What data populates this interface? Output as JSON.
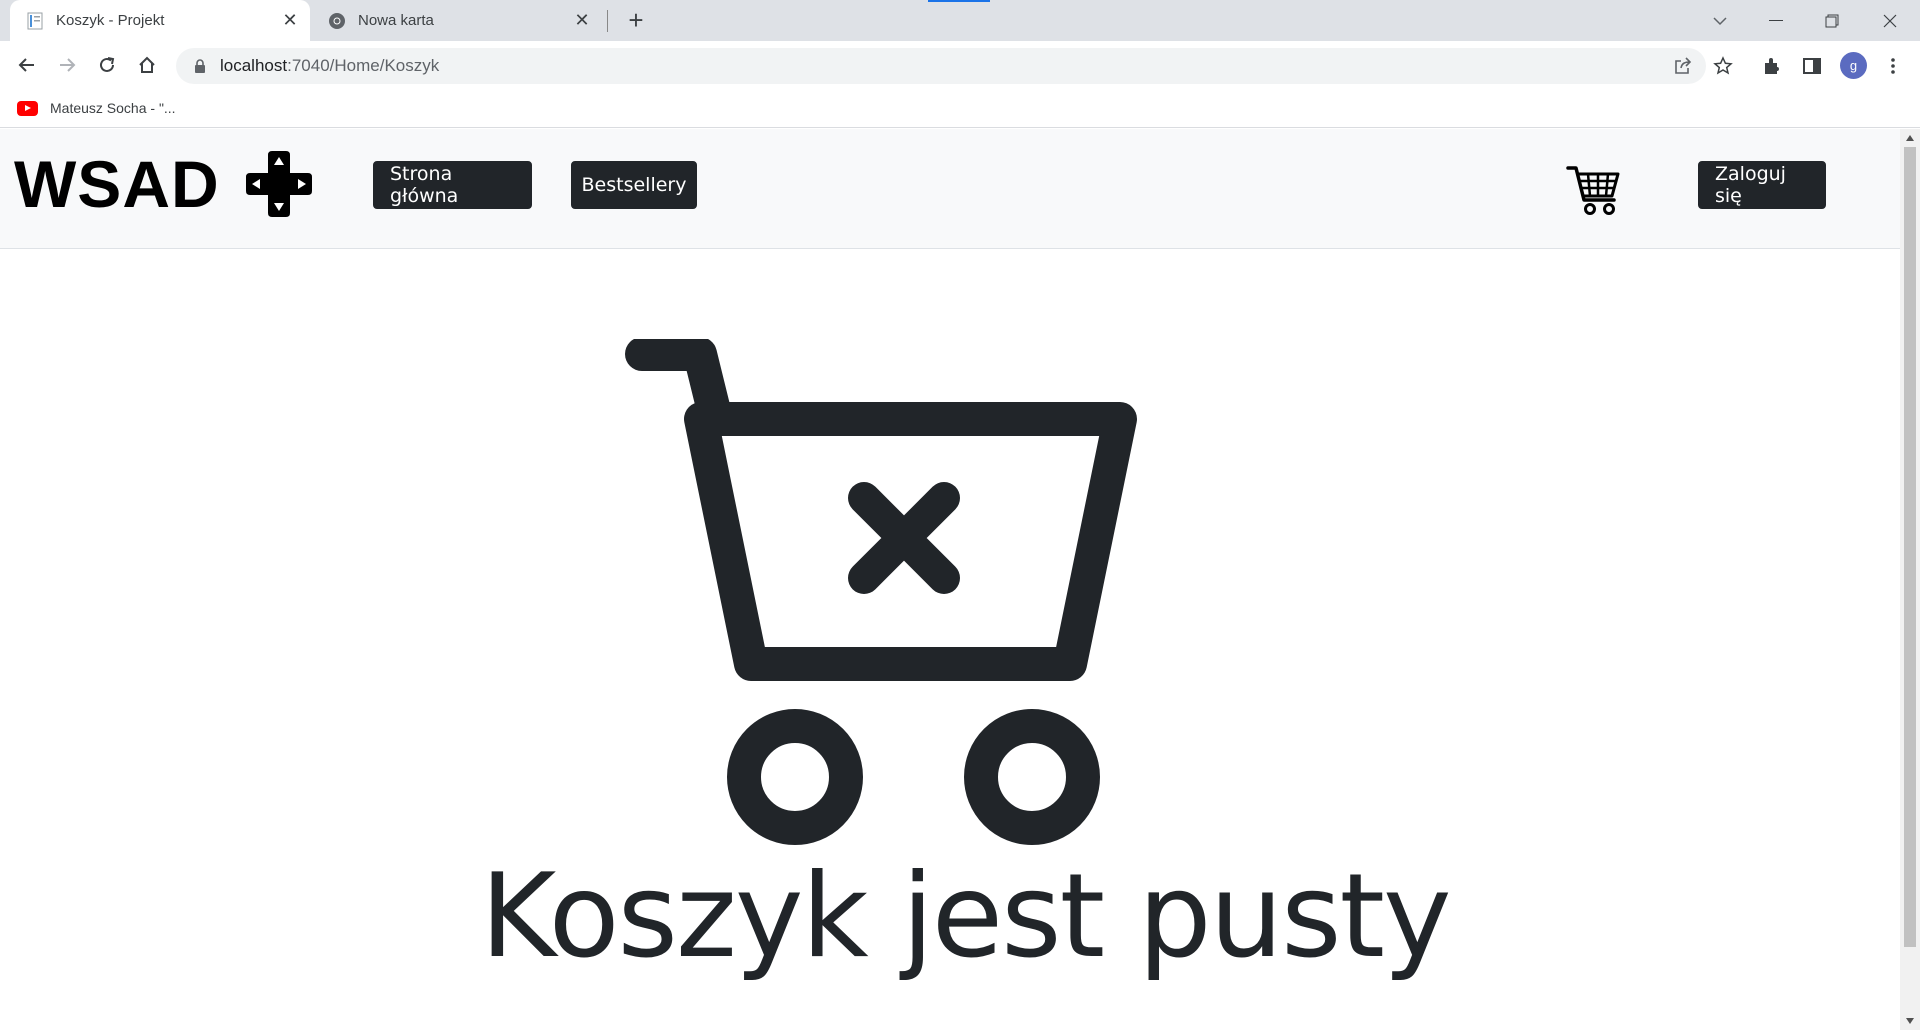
{
  "browser": {
    "tabs": [
      {
        "title": "Koszyk - Projekt",
        "active": true
      },
      {
        "title": "Nowa karta",
        "active": false
      }
    ],
    "url_host": "localhost",
    "url_rest": ":7040/Home/Koszyk",
    "profile_initial": "g",
    "bookmarks": [
      {
        "label": "Mateusz Socha - \"..."
      }
    ]
  },
  "site": {
    "brand": "WSAD",
    "nav": {
      "home_label": "Strona główna",
      "bestsellers_label": "Bestsellery",
      "login_label": "Zaloguj się"
    }
  },
  "main": {
    "empty_message": "Koszyk jest pusty"
  },
  "colors": {
    "dark": "#212529",
    "navbar_bg": "#f8f9fa"
  },
  "icons": {
    "brand": "gamepad-dpad-icon",
    "cart": "shopping-cart-icon",
    "empty_cart": "cart-x-icon"
  }
}
